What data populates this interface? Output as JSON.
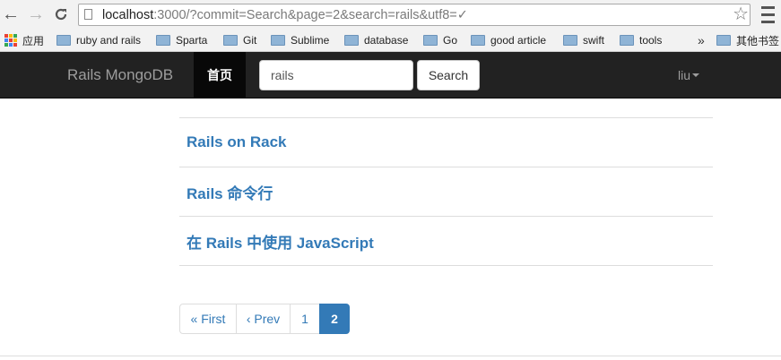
{
  "browser": {
    "url_host": "localhost",
    "url_rest": ":3000/?commit=Search&page=2&search=rails&utf8=✓"
  },
  "bookmarks": {
    "apps": "应用",
    "items": [
      "ruby and rails",
      "Sparta",
      "Git",
      "Sublime",
      "database",
      "Go",
      "good article",
      "swift",
      "tools"
    ],
    "more": "»",
    "other": "其他书签"
  },
  "navbar": {
    "brand": "Rails MongoDB",
    "active_item": "首页",
    "search_value": "rails",
    "search_button": "Search",
    "user": "liu"
  },
  "results": [
    {
      "title": "Rails on Rack"
    },
    {
      "title": "Rails 命令行"
    },
    {
      "title": "在 Rails 中使用 JavaScript"
    }
  ],
  "pagination": {
    "first": "« First",
    "prev": "‹ Prev",
    "pages": [
      "1",
      "2"
    ],
    "current": "2"
  },
  "colors": {
    "navbar_bg": "#222222",
    "link": "#337ab7",
    "active_page": "#337ab7"
  }
}
